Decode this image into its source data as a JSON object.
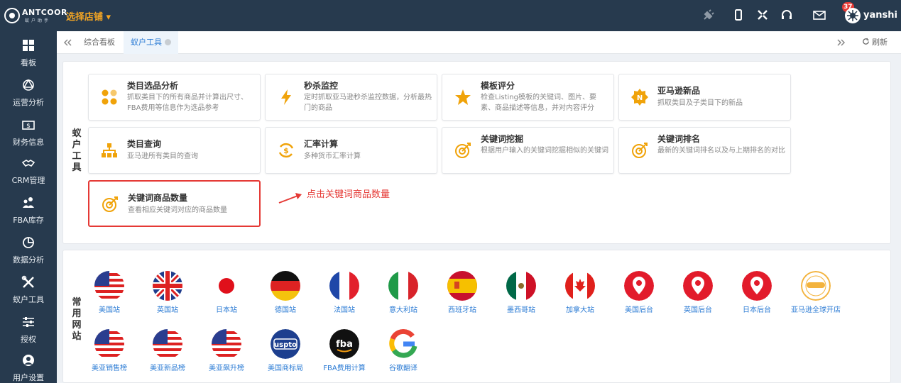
{
  "brand": {
    "name": "ANTCOOR",
    "sub": "蚁户助手"
  },
  "header": {
    "store_select": "选择店铺 ▾",
    "username": "yanshi",
    "message_count": "37"
  },
  "sidebar": {
    "items": [
      {
        "label": "看板",
        "icon": "dashboard-icon"
      },
      {
        "label": "运营分析",
        "icon": "operations-icon"
      },
      {
        "label": "财务信息",
        "icon": "finance-icon"
      },
      {
        "label": "CRM管理",
        "icon": "crm-icon"
      },
      {
        "label": "FBA库存",
        "icon": "inventory-icon"
      },
      {
        "label": "数据分析",
        "icon": "analytics-icon"
      },
      {
        "label": "蚁户工具",
        "icon": "tools-icon"
      },
      {
        "label": "授权",
        "icon": "authorize-icon"
      },
      {
        "label": "用户设置",
        "icon": "user-settings-icon"
      }
    ]
  },
  "tabs": {
    "items": [
      {
        "label": "综合看板"
      },
      {
        "label": "蚁户工具"
      }
    ],
    "refresh_label": "刷新"
  },
  "tools": {
    "section_label": "蚁户工具",
    "cards": [
      {
        "title": "类目选品分析",
        "desc": "抓取类目下的所有商品并计算出尺寸、FBA费用等信息作为选品参考",
        "icon": "category-select-icon",
        "color": "#f0a30a"
      },
      {
        "title": "秒杀监控",
        "desc": "定时抓取亚马逊秒杀监控数据，分析最热门的商品",
        "icon": "lightning-icon",
        "color": "#f0a30a"
      },
      {
        "title": "模板评分",
        "desc": "检查Listing模板的关键词、图片、要素、商品描述等信息，并对内容评分",
        "icon": "star-icon",
        "color": "#f0a30a"
      },
      {
        "title": "亚马逊新品",
        "desc": "抓取类目及子类目下的新品",
        "icon": "new-badge-icon",
        "color": "#f0a30a"
      },
      {
        "title": "类目查询",
        "desc": "亚马逊所有类目的查询",
        "icon": "sitemap-icon",
        "color": "#f0a30a"
      },
      {
        "title": "汇率计算",
        "desc": "多种货币汇率计算",
        "icon": "exchange-icon",
        "color": "#f0a30a"
      },
      {
        "title": "关键词挖掘",
        "desc": "根据用户输入的关键词挖掘相似的关键词",
        "icon": "target-icon",
        "color": "#f0a30a"
      },
      {
        "title": "关键词排名",
        "desc": "最新的关键词排名以及与上期排名的对比",
        "icon": "target-icon",
        "color": "#f0a30a"
      },
      {
        "title": "关键词商品数量",
        "desc": "查看相应关键词对应的商品数量",
        "icon": "target-icon",
        "color": "#f0a30a"
      }
    ],
    "hint": "点击关键词商品数量",
    "highlight_color": "#e53935"
  },
  "sites": {
    "section_label": "常用网站",
    "items": [
      {
        "label": "美国站",
        "icon": "us-flag-icon"
      },
      {
        "label": "英国站",
        "icon": "uk-flag-icon"
      },
      {
        "label": "日本站",
        "icon": "jp-flag-icon"
      },
      {
        "label": "德国站",
        "icon": "de-flag-icon"
      },
      {
        "label": "法国站",
        "icon": "fr-flag-icon"
      },
      {
        "label": "意大利站",
        "icon": "it-flag-icon"
      },
      {
        "label": "西班牙站",
        "icon": "es-flag-icon"
      },
      {
        "label": "墨西哥站",
        "icon": "mx-flag-icon"
      },
      {
        "label": "加拿大站",
        "icon": "ca-flag-icon"
      },
      {
        "label": "美国后台",
        "icon": "location-pin-icon"
      },
      {
        "label": "英国后台",
        "icon": "location-pin-icon"
      },
      {
        "label": "日本后台",
        "icon": "location-pin-icon"
      },
      {
        "label": "亚马逊全球开店",
        "icon": "global-selling-icon"
      },
      {
        "label": "美亚销售榜",
        "icon": "us-flag-icon"
      },
      {
        "label": "美亚新品榜",
        "icon": "us-flag-icon"
      },
      {
        "label": "美亚飙升榜",
        "icon": "us-flag-icon"
      },
      {
        "label": "美国商标局",
        "icon": "uspto-icon",
        "logo_text": "uspto"
      },
      {
        "label": "FBA费用计算",
        "icon": "fba-icon",
        "logo_text": "fba"
      },
      {
        "label": "谷歌翻译",
        "icon": "google-icon"
      }
    ]
  },
  "colors": {
    "sidebar_bg": "#273a4e",
    "accent": "#2b7bd4",
    "store": "#f5a623",
    "highlight": "#e53935"
  }
}
